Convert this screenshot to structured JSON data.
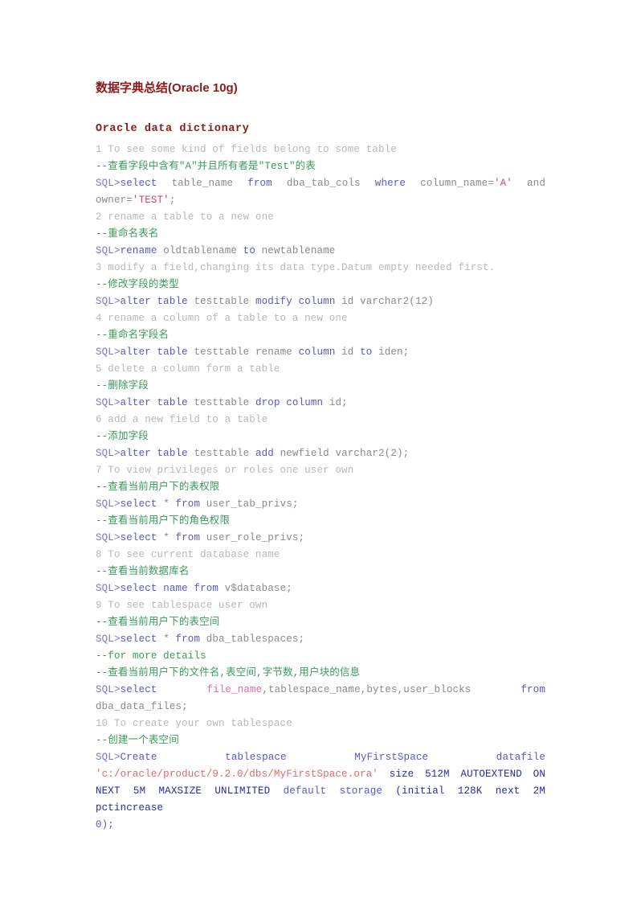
{
  "document": {
    "title": "数据字典总结(Oracle 10g)",
    "section_heading": "Oracle data dictionary",
    "lines": {
      "l1_desc": "1 To see some kind of fields belong to some table",
      "l1_cn": "--查看字段中含有\"A\"并且所有者是\"Test\"的表",
      "l1_sql_prompt": "SQL>",
      "l1_sql_select": "select",
      "l1_sql_tablename": "table_name",
      "l1_sql_from": "from",
      "l1_sql_dbatabcols": "dba_tab_cols",
      "l1_sql_where": "where",
      "l1_sql_colname": "column_name=",
      "l1_sql_strA": "'A'",
      "l1_sql_and": "and",
      "l1_sql_owner": "owner=",
      "l1_sql_strTEST": "'TEST'",
      "l1_sql_semi": ";",
      "l2_desc": "2 rename a table to a new one",
      "l2_cn": "--重命名表名",
      "l2_sql_prompt": "SQL>",
      "l2_sql_rename": "rename",
      "l2_sql_old": "oldtablename",
      "l2_sql_to": "to",
      "l2_sql_new": "newtablename",
      "l3_desc": "3 modify a field,changing its data type.Datum empty needed first.",
      "l3_cn": "--修改字段的类型",
      "l3_sql_prompt": "SQL>",
      "l3_sql_alter": "alter",
      "l3_sql_table": "table",
      "l3_sql_testtable": "testtable",
      "l3_sql_modify": "modify",
      "l3_sql_column": "column",
      "l3_sql_id": "id varchar2(12)",
      "l4_desc": "4 rename a column of a table to a new one",
      "l4_cn": "--重命名字段名",
      "l4_sql_prompt": "SQL>",
      "l4_sql_alter": "alter",
      "l4_sql_table": "table",
      "l4_sql_testtable": "testtable",
      "l4_sql_rename": "rename",
      "l4_sql_column": "column",
      "l4_sql_id": "id",
      "l4_sql_to": "to",
      "l4_sql_iden": "iden;",
      "l5_desc": "5 delete a column form a table",
      "l5_cn": "--删除字段",
      "l5_sql_prompt": "SQL>",
      "l5_sql_alter": "alter",
      "l5_sql_table": "table",
      "l5_sql_testtable": "testtable",
      "l5_sql_drop": "drop",
      "l5_sql_column": "column",
      "l5_sql_id": "id;",
      "l6_desc": "6 add a new field to a table",
      "l6_cn": "--添加字段",
      "l6_sql_prompt": "SQL>",
      "l6_sql_alter": "alter",
      "l6_sql_table": "table",
      "l6_sql_testtable": "testtable",
      "l6_sql_add": "add",
      "l6_sql_newfield": "newfield varchar2(2);",
      "l7_desc": "7 To view privileges or roles one user own",
      "l7_cn_a": "--查看当前用户下的表权限",
      "l7_sql_a_prompt": "SQL>",
      "l7_sql_a_select": "select",
      "l7_sql_a_star": "*",
      "l7_sql_a_from": "from",
      "l7_sql_a_table": "user_tab_privs;",
      "l7_cn_b": "--查看当前用户下的角色权限",
      "l7_sql_b_prompt": "SQL>",
      "l7_sql_b_select": "select",
      "l7_sql_b_star": "*",
      "l7_sql_b_from": "from",
      "l7_sql_b_table": "user_role_privs;",
      "l8_desc": "8 To see current database name",
      "l8_cn": "--查看当前数据库名",
      "l8_sql_prompt": "SQL>",
      "l8_sql_select": "select",
      "l8_sql_name": "name",
      "l8_sql_from": "from",
      "l8_sql_table": "v$database;",
      "l9_desc": "9 To see tablespace user own",
      "l9_cn": "--查看当前用户下的表空间",
      "l9_sql_prompt": "SQL>",
      "l9_sql_select": "select",
      "l9_sql_star": "*",
      "l9_sql_from": "from",
      "l9_sql_table": "dba_tablespaces;",
      "l9_cn_more": "--for more details",
      "l9_cn_detail": "--查看当前用户下的文件名,表空间,字节数,用户块的信息",
      "l9_sql2_prompt": "SQL>",
      "l9_sql2_select": "select",
      "l9_sql2_filename": "file_name",
      "l9_sql2_cols": ",tablespace_name,bytes,user_blocks",
      "l9_sql2_from": "from",
      "l9_sql2_table": "dba_data_files;",
      "l10_desc": "10 To create your own tablespace",
      "l10_cn": "--创建一个表空间",
      "l10_sql_prompt": "SQL>",
      "l10_sql_create": "Create",
      "l10_sql_tablespace": "tablespace",
      "l10_sql_spacename": "MyFirstSpace",
      "l10_sql_datafile": "datafile",
      "l10_sql_path": "'c:/oracle/product/9.2.0/dbs/MyFirstSpace.ora'",
      "l10_sql_size": "size 512M  AUTOEXTEND ON NEXT 5M MAXSIZE UNLIMITED",
      "l10_sql_default": "default storage",
      "l10_sql_storage": "(initial 128K next 2M pctincrease",
      "l10_sql_end": "0);"
    }
  },
  "colors": {
    "title": "#8B1A1A",
    "comment_green": "#3a9a5c",
    "keyword_blue": "#5b56c8",
    "identifier_gray": "#8a8a8a",
    "description_gray": "#b8b8b8",
    "string_red": "#e0425a",
    "pink": "#e06aa8",
    "navy": "#2b2b9e",
    "background": "#ffffff"
  }
}
